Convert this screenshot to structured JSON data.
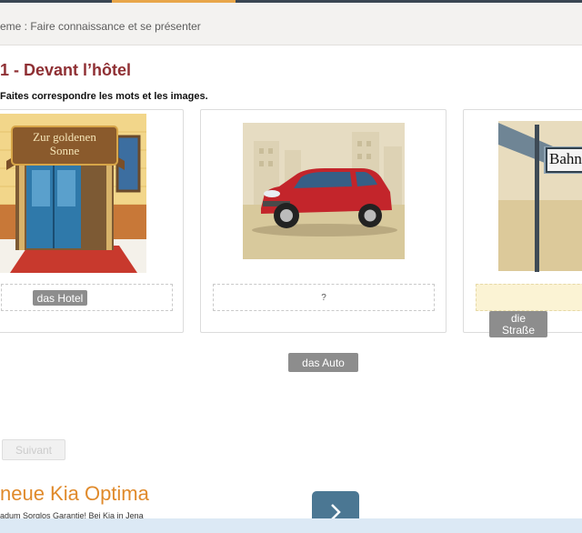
{
  "breadcrumb": {
    "text": "eme : Faire connaissance et se présenter"
  },
  "exercise": {
    "title": "1 - Devant l’hôtel",
    "instruction": "Faites correspondre les mots et les images."
  },
  "cards": [
    {
      "sign_line1": "Zur goldenen",
      "sign_line2": "Sonne",
      "dropzone_value": ""
    },
    {
      "dropzone_value": "?"
    },
    {
      "street_sign": "Bahn",
      "dropzone_value": ""
    }
  ],
  "word_chips": {
    "hotel": "das Hotel",
    "strasse_line1": "die",
    "strasse_line2": "Straße",
    "auto": "das Auto"
  },
  "next_button": {
    "label": "Suivant",
    "enabled": false
  },
  "ad": {
    "title": "neue Kia Optima",
    "subtitle": "adum Sorglos Garantie! Bei Kia in Jena"
  },
  "colors": {
    "title": "#8f3034",
    "chip": "#8d8d8d",
    "ad_title": "#e08a2b",
    "ad_button": "#4b7793",
    "accent_tab": "#e8a64a"
  }
}
